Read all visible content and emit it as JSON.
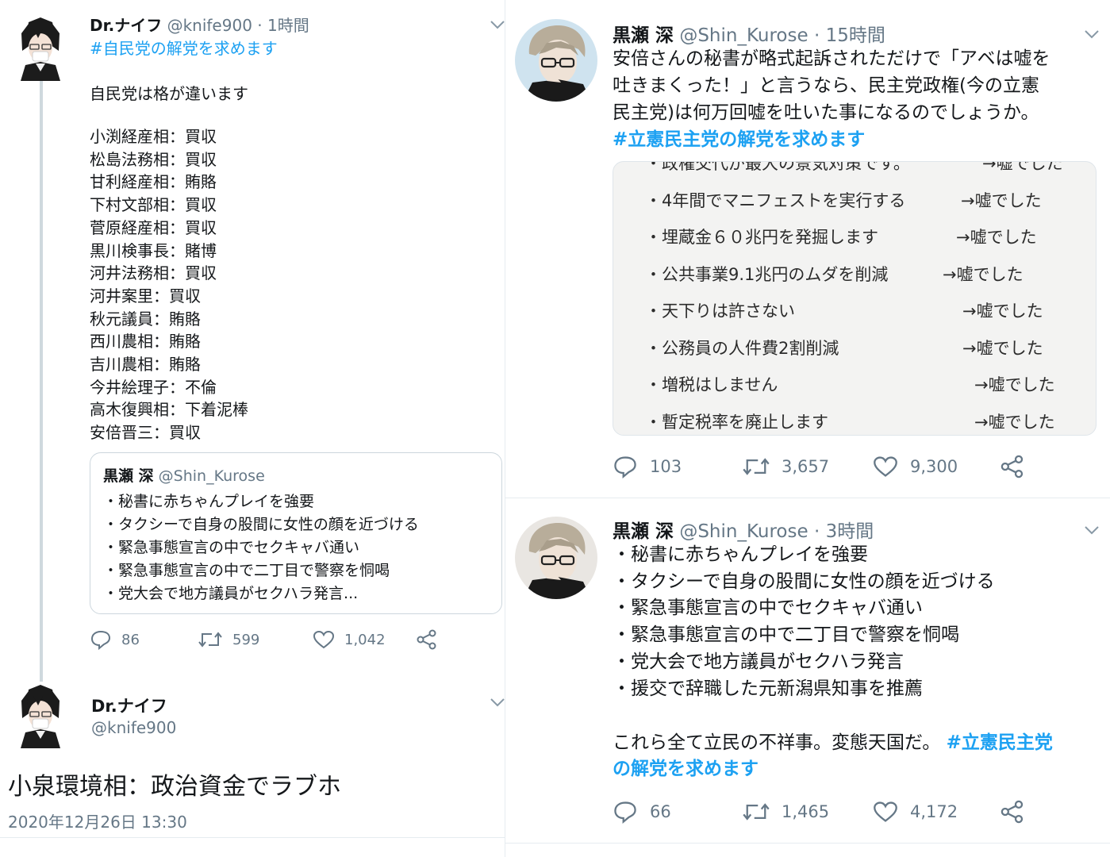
{
  "left_thread": {
    "tweet1": {
      "display_name": "Dr.ナイフ",
      "handle": "@knife900",
      "time": "· 1時間",
      "hashtag": "#自民党の解党を求めます",
      "lead": "自民党は格が違います",
      "scandals": [
        "小渕経産相：買収",
        "松島法務相：買収",
        "甘利経産相：賄賂",
        "下村文部相：買収",
        "菅原経産相：買収",
        "黒川検事長：賭博",
        "河井法務相：買収",
        "河井案里：買収",
        "秋元議員：賄賂",
        "西川農相：賄賂",
        "吉川農相：賄賂",
        "今井絵理子：不倫",
        "高木復興相：下着泥棒",
        "安倍晋三：買収"
      ],
      "quote": {
        "display_name": "黒瀬 深",
        "handle": "@Shin_Kurose",
        "lines": [
          "・秘書に赤ちゃんプレイを強要",
          "・タクシーで自身の股間に女性の顔を近づける",
          "・緊急事態宣言の中でセクキャバ通い",
          "・緊急事態宣言の中で二丁目で警察を恫喝",
          "・党大会で地方議員がセクハラ発言..."
        ]
      },
      "replies": "86",
      "retweets": "599",
      "likes": "1,042"
    },
    "tweet2": {
      "display_name": "Dr.ナイフ",
      "handle": "@knife900",
      "body": "小泉環境相：政治資金でラブホ",
      "timestamp": "2020年12月26日 13:30"
    }
  },
  "right_column": {
    "tweet1": {
      "display_name": "黒瀬 深",
      "handle": "@Shin_Kurose",
      "time": "· 15時間",
      "body_lines": [
        "安倍さんの秘書が略式起訴されただけで「アベは嘘を",
        "吐きまくった！」と言うなら、民主党政権(今の立憲",
        "民主党)は何万回嘘を吐いた事になるのでしょうか。"
      ],
      "hashtag": "#立憲民主党の解党を求めます",
      "image_rows": [
        {
          "left": "・政権交代が最大の景気対策です。",
          "right": "→嘘でした"
        },
        {
          "left": "・4年間でマニフェストを実行する",
          "right": "→嘘でした"
        },
        {
          "left": "・埋蔵金６０兆円を発掘します",
          "right": "→嘘でした"
        },
        {
          "left": "・公共事業9.1兆円のムダを削減",
          "right": "→嘘でした"
        },
        {
          "left": "・天下りは許さない",
          "right": "→嘘でした"
        },
        {
          "left": "・公務員の人件費2割削減",
          "right": "→嘘でした"
        },
        {
          "left": "・増税はしません",
          "right": "→嘘でした"
        },
        {
          "left": "・暫定税率を廃止します",
          "right": "→嘘でした"
        }
      ],
      "replies": "103",
      "retweets": "3,657",
      "likes": "9,300"
    },
    "tweet2": {
      "display_name": "黒瀬 深",
      "handle": "@Shin_Kurose",
      "time": "· 3時間",
      "lines": [
        "・秘書に赤ちゃんプレイを強要",
        "・タクシーで自身の股間に女性の顔を近づける",
        "・緊急事態宣言の中でセクキャバ通い",
        "・緊急事態宣言の中で二丁目で警察を恫喝",
        "・党大会で地方議員がセクハラ発言",
        "・援交で辞職した元新潟県知事を推薦"
      ],
      "tail_text": "これら全て立民の不祥事。変態天国だ。",
      "tail_hashtag_1": "#立憲民主党",
      "tail_hashtag_2": "の解党を求めます",
      "replies": "66",
      "retweets": "1,465",
      "likes": "4,172"
    }
  },
  "colors": {
    "link": "#1da1f2",
    "muted": "#657786",
    "text": "#14171a"
  }
}
